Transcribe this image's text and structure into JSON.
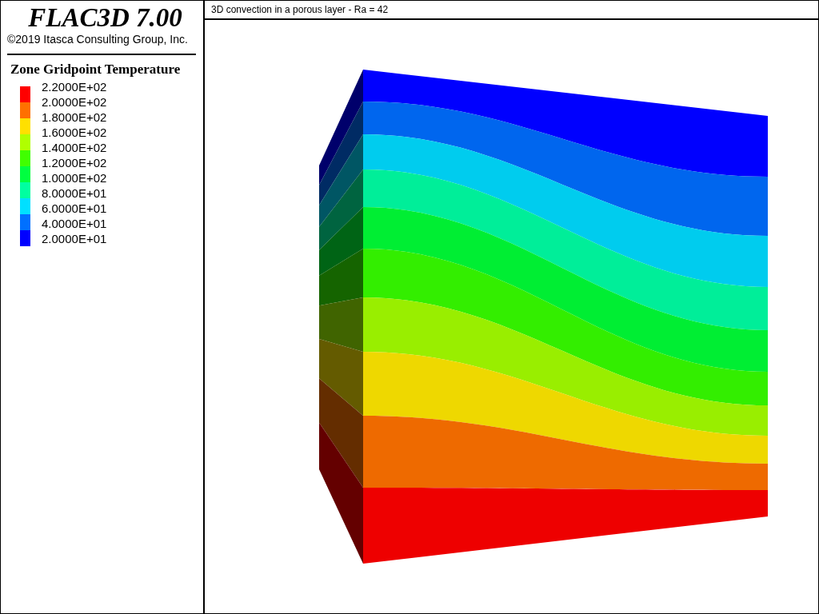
{
  "sidebar": {
    "title": "FLAC3D 7.00",
    "copyright": "©2019 Itasca Consulting Group, Inc.",
    "legend": {
      "title": "Zone Gridpoint Temperature",
      "swatches": [
        {
          "color": "#ff0000"
        },
        {
          "color": "#ff7000"
        },
        {
          "color": "#ffe000"
        },
        {
          "color": "#b0ff00"
        },
        {
          "color": "#40ff00"
        },
        {
          "color": "#00ff40"
        },
        {
          "color": "#00ffa0"
        },
        {
          "color": "#00e0ff"
        },
        {
          "color": "#0070ff"
        },
        {
          "color": "#0000ff"
        }
      ],
      "labels": [
        "2.2000E+02",
        "2.0000E+02",
        "1.8000E+02",
        "1.6000E+02",
        "1.4000E+02",
        "1.2000E+02",
        "1.0000E+02",
        "8.0000E+01",
        "6.0000E+01",
        "4.0000E+01",
        "2.0000E+01"
      ]
    }
  },
  "plot": {
    "title": "3D convection in a porous layer - Ra = 42"
  }
}
